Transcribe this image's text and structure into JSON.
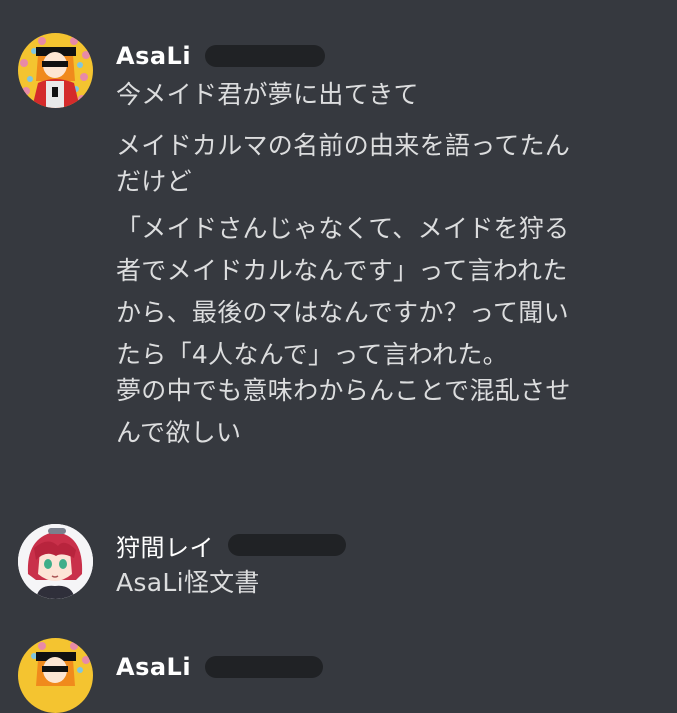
{
  "messages": [
    {
      "author": "AsaLi",
      "lines": [
        "今メイド君が夢に出てきて",
        "メイドカルマの名前の由来を語ってたん",
        "だけど",
        "「メイドさんじゃなくて、メイドを狩る",
        "者でメイドカルなんです」って言われた",
        "から、最後のマはなんですか？って聞い",
        "たら「4人なんで」って言われた。",
        "夢の中でも意味わからんことで混乱させ",
        "んで欲しい"
      ]
    },
    {
      "author": "狩間レイ",
      "lines": [
        "AsaLi怪文書"
      ]
    },
    {
      "author": "AsaLi",
      "lines": []
    }
  ]
}
